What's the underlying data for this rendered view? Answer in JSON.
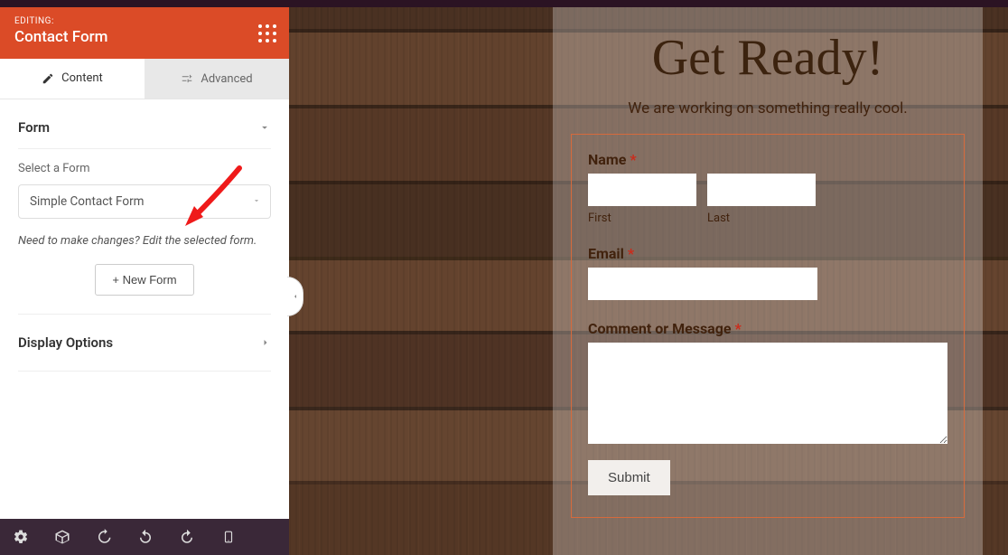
{
  "header": {
    "editing_label": "EDITING:",
    "widget_title": "Contact Form"
  },
  "tabs": {
    "content": "Content",
    "advanced": "Advanced"
  },
  "form_section": {
    "title": "Form",
    "select_label": "Select a Form",
    "selected_form": "Simple Contact Form",
    "hint": "Need to make changes? Edit the selected form.",
    "new_form_button": "+ New Form"
  },
  "display_options": {
    "title": "Display Options"
  },
  "preview": {
    "hero_title": "Get Ready!",
    "hero_sub": "We are working on something really cool.",
    "name_label": "Name",
    "first_label": "First",
    "last_label": "Last",
    "email_label": "Email",
    "comment_label": "Comment or Message",
    "submit_label": "Submit",
    "required_marker": "*"
  },
  "colors": {
    "elementor_orange": "#db4b27",
    "selection_orange": "#d66a3c",
    "required_red": "#cc2a1a"
  }
}
